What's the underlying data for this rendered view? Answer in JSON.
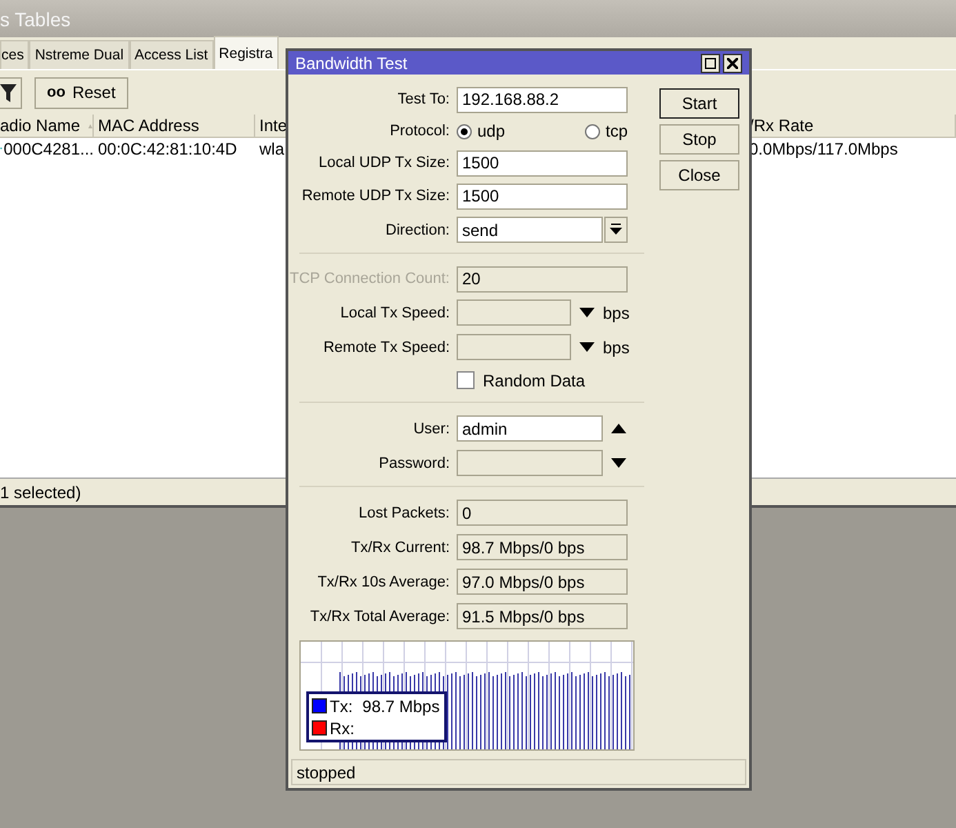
{
  "background_window": {
    "title": "s Tables",
    "tabs": [
      {
        "label": "ces",
        "selected": false
      },
      {
        "label": "Nstreme Dual",
        "selected": false
      },
      {
        "label": "Access List",
        "selected": false
      },
      {
        "label": "Registra",
        "selected": true
      }
    ],
    "toolbar": {
      "reset_glyph": "oo",
      "reset_label": "Reset"
    },
    "table": {
      "columns": [
        "adio Name",
        "MAC Address",
        "Inte",
        "/Rx Rate"
      ],
      "rows": [
        {
          "cells": [
            "000C4281...",
            "00:0C:42:81:10:4D",
            "wla",
            "0.0Mbps/117.0Mbps"
          ]
        }
      ]
    },
    "status": "1 selected)"
  },
  "dialog": {
    "title": "Bandwidth Test",
    "buttons": [
      "Start",
      "Stop",
      "Close"
    ],
    "sections": [
      {
        "fields": [
          {
            "kind": "text",
            "label": "Test To:",
            "value": "192.168.88.2",
            "disabled": false
          },
          {
            "kind": "radio",
            "label": "Protocol:",
            "options": [
              {
                "label": "udp",
                "selected": true
              },
              {
                "label": "tcp",
                "selected": false
              }
            ]
          },
          {
            "kind": "text",
            "label": "Local UDP Tx Size:",
            "value": "1500",
            "disabled": false
          },
          {
            "kind": "text",
            "label": "Remote UDP Tx Size:",
            "value": "1500",
            "disabled": false
          },
          {
            "kind": "combo",
            "label": "Direction:",
            "value": "send"
          }
        ]
      },
      {
        "fields": [
          {
            "kind": "text",
            "label": "TCP Connection Count:",
            "value": "20",
            "disabled": true
          },
          {
            "kind": "speed",
            "label": "Local Tx Speed:",
            "unit": "bps"
          },
          {
            "kind": "speed",
            "label": "Remote Tx Speed:",
            "unit": "bps"
          },
          {
            "kind": "checkbox",
            "label": "Random Data",
            "checked": false
          }
        ]
      },
      {
        "fields": [
          {
            "kind": "optional",
            "label": "User:",
            "value": "admin",
            "set": true
          },
          {
            "kind": "optional",
            "label": "Password:",
            "set": false
          }
        ]
      },
      {
        "fields": [
          {
            "kind": "readonly",
            "label": "Lost Packets:",
            "value": "0"
          },
          {
            "kind": "readonly",
            "label": "Tx/Rx Current:",
            "value": "98.7 Mbps/0 bps"
          },
          {
            "kind": "readonly",
            "label": "Tx/Rx 10s Average:",
            "value": "97.0 Mbps/0 bps"
          },
          {
            "kind": "readonly",
            "label": "Tx/Rx Total Average:",
            "value": "91.5 Mbps/0 bps"
          }
        ]
      }
    ],
    "graph": {
      "legend": [
        {
          "label": "Tx:",
          "reading": "98.7 Mbps",
          "color": "#0000ff"
        },
        {
          "label": "Rx:",
          "color": "#ff0000"
        }
      ]
    },
    "status": "stopped"
  }
}
